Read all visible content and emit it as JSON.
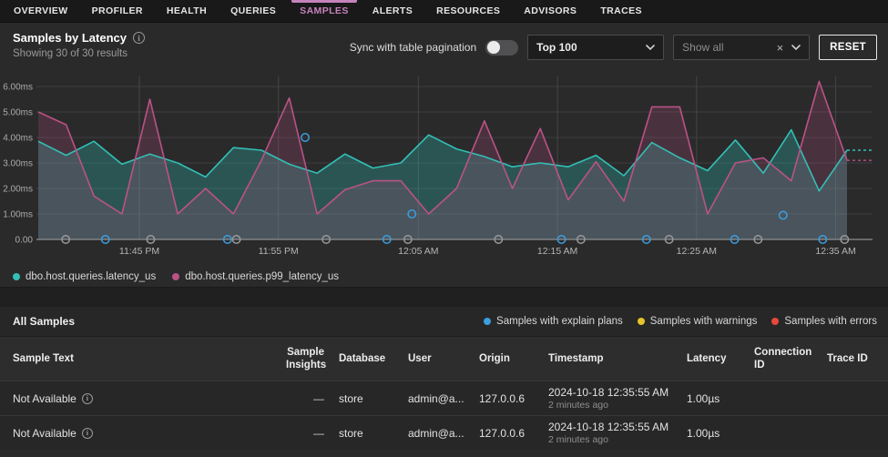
{
  "nav": {
    "tabs": [
      {
        "label": "OVERVIEW",
        "active": false
      },
      {
        "label": "PROFILER",
        "active": false
      },
      {
        "label": "HEALTH",
        "active": false
      },
      {
        "label": "QUERIES",
        "active": false
      },
      {
        "label": "SAMPLES",
        "active": true
      },
      {
        "label": "ALERTS",
        "active": false
      },
      {
        "label": "RESOURCES",
        "active": false
      },
      {
        "label": "ADVISORS",
        "active": false
      },
      {
        "label": "TRACES",
        "active": false
      }
    ],
    "active_color": "#c583bb"
  },
  "panel": {
    "title": "Samples by Latency",
    "subtitle": "Showing 30 of 30 results",
    "sync_label": "Sync with table pagination",
    "sync_enabled": false,
    "limit_select_value": "Top 100",
    "filter_placeholder": "Show all",
    "reset_label": "RESET"
  },
  "chart_data": {
    "type": "area",
    "unit": "ms",
    "ylim": [
      0,
      6.2
    ],
    "ytick_labels": [
      "0.00",
      "1.00ms",
      "2.00ms",
      "3.00ms",
      "4.00ms",
      "5.00ms",
      "6.00ms"
    ],
    "xtick_labels": [
      "11:45 PM",
      "11:55 PM",
      "12:05 AM",
      "12:15 AM",
      "12:25 AM",
      "12:35 AM"
    ],
    "xtick_fracs": [
      0.125,
      0.297,
      0.47,
      0.642,
      0.814,
      0.986
    ],
    "grid": true,
    "legend_position": "bottom-left",
    "series": [
      {
        "name": "dbo.host.queries.latency_us",
        "color": "#32bfb6",
        "fill": "rgba(47,184,175,0.30)",
        "values": [
          3.85,
          3.3,
          3.85,
          2.95,
          3.35,
          3.0,
          2.45,
          3.6,
          3.5,
          2.95,
          2.6,
          3.35,
          2.8,
          3.0,
          4.1,
          3.55,
          3.25,
          2.85,
          3.0,
          2.85,
          3.3,
          2.5,
          3.8,
          3.2,
          2.7,
          3.9,
          2.6,
          4.3,
          1.9,
          3.5
        ]
      },
      {
        "name": "dbo.host.queries.p99_latency_us",
        "color": "#bb5286",
        "fill": "rgba(187,82,134,0.22)",
        "values": [
          5.0,
          4.5,
          1.7,
          1.0,
          5.5,
          1.0,
          2.0,
          1.0,
          3.1,
          5.55,
          1.0,
          1.95,
          2.3,
          2.3,
          1.0,
          2.0,
          4.65,
          2.0,
          4.35,
          1.55,
          3.05,
          1.5,
          5.2,
          5.2,
          1.0,
          3.0,
          3.2,
          2.3,
          6.2,
          3.1
        ]
      }
    ],
    "sample_markers": [
      [
        0.034,
        0,
        "gray"
      ],
      [
        0.083,
        0,
        "blue"
      ],
      [
        0.139,
        0,
        "gray"
      ],
      [
        0.234,
        0,
        "blue"
      ],
      [
        0.245,
        0,
        "gray"
      ],
      [
        0.33,
        4.0,
        "blue"
      ],
      [
        0.356,
        0,
        "gray"
      ],
      [
        0.431,
        0,
        "blue"
      ],
      [
        0.457,
        0,
        "gray"
      ],
      [
        0.462,
        1.0,
        "blue"
      ],
      [
        0.569,
        0,
        "gray"
      ],
      [
        0.647,
        0,
        "blue"
      ],
      [
        0.671,
        0,
        "gray"
      ],
      [
        0.752,
        0,
        "blue"
      ],
      [
        0.78,
        0,
        "gray"
      ],
      [
        0.861,
        0,
        "blue"
      ],
      [
        0.89,
        0,
        "gray"
      ],
      [
        0.921,
        0.95,
        "blue"
      ],
      [
        0.97,
        0,
        "blue"
      ],
      [
        0.997,
        0,
        "gray"
      ]
    ],
    "marker_colors": {
      "gray": "#9a9a9a",
      "blue": "#3b9fe0"
    }
  },
  "samples_section": {
    "title": "All Samples",
    "legend": [
      {
        "label": "Samples with explain plans",
        "color": "#3b9fe0"
      },
      {
        "label": "Samples with warnings",
        "color": "#e5c32a"
      },
      {
        "label": "Samples with errors",
        "color": "#e8493a"
      }
    ]
  },
  "table": {
    "columns": [
      {
        "key": "sample_text",
        "label": "Sample Text"
      },
      {
        "key": "insights",
        "label": "Sample Insights"
      },
      {
        "key": "database",
        "label": "Database"
      },
      {
        "key": "user",
        "label": "User"
      },
      {
        "key": "origin",
        "label": "Origin"
      },
      {
        "key": "timestamp",
        "label": "Timestamp"
      },
      {
        "key": "latency",
        "label": "Latency"
      },
      {
        "key": "connection_id",
        "label": "Connection ID"
      },
      {
        "key": "trace_id",
        "label": "Trace ID"
      }
    ],
    "rows": [
      {
        "sample_text": "Not Available",
        "has_info_icon": true,
        "insights": "—",
        "database": "store",
        "user": "admin@a...",
        "origin": "127.0.0.6",
        "timestamp": "2024-10-18 12:35:55 AM",
        "timestamp_relative": "2 minutes ago",
        "latency": "1.00µs",
        "connection_id": "",
        "trace_id": ""
      },
      {
        "sample_text": "Not Available",
        "has_info_icon": true,
        "insights": "—",
        "database": "store",
        "user": "admin@a...",
        "origin": "127.0.0.6",
        "timestamp": "2024-10-18 12:35:55 AM",
        "timestamp_relative": "2 minutes ago",
        "latency": "1.00µs",
        "connection_id": "",
        "trace_id": ""
      }
    ]
  }
}
